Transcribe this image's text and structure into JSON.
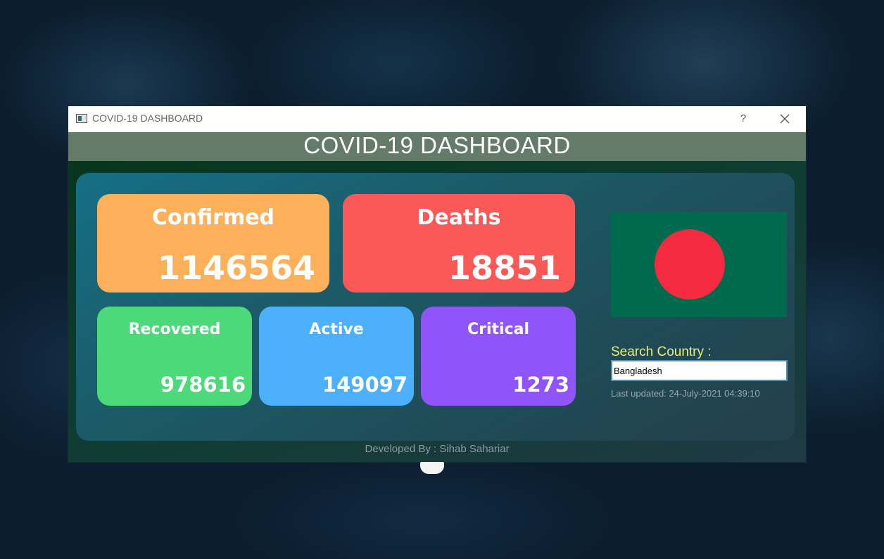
{
  "window": {
    "title": "COVID-19 DASHBOARD",
    "help_label": "?",
    "close_icon": "close-icon"
  },
  "header": {
    "title": "COVID-19 DASHBOARD"
  },
  "stats": {
    "confirmed": {
      "label": "Confirmed",
      "value": "1146564",
      "color": "#fdb05a"
    },
    "deaths": {
      "label": "Deaths",
      "value": "18851",
      "color": "#fb5858"
    },
    "recovered": {
      "label": "Recovered",
      "value": "978616",
      "color": "#4bd97a"
    },
    "active": {
      "label": "Active",
      "value": "149097",
      "color": "#4cb0fd"
    },
    "critical": {
      "label": "Critical",
      "value": "1273",
      "color": "#9054fb"
    }
  },
  "flag": {
    "country": "Bangladesh",
    "field_color": "#006a4e",
    "disc_color": "#f42a41"
  },
  "search": {
    "label": "Search Country :",
    "value": "Bangladesh"
  },
  "last_updated": "Last updated: 24-July-2021 04:39:10",
  "footer": "Developed By : Sihab Sahariar"
}
